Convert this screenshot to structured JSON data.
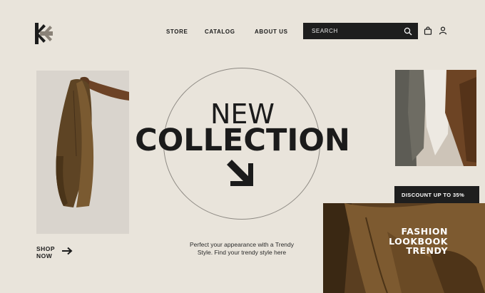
{
  "brand": {
    "logo_icon": "geometric-asterisk-logo"
  },
  "nav": [
    {
      "label": "STORE"
    },
    {
      "label": "CATALOG"
    },
    {
      "label": "ABOUT US"
    }
  ],
  "search": {
    "placeholder": "SEARCH",
    "icon": "search-icon"
  },
  "header_icons": {
    "bag": "shopping-bag-icon",
    "user": "user-icon"
  },
  "hero": {
    "line1": "NEW",
    "line2": "COLLECTION",
    "arrow_icon": "arrow-down-right-icon"
  },
  "tagline": "Perfect your appearance with a Trendy Style. Find your trendy style here",
  "shop": {
    "line1": "SHOP",
    "line2": "NOW",
    "icon": "arrow-right-icon"
  },
  "discount": {
    "label": "DISCOUNT UP TO 35%"
  },
  "lookbook": {
    "line1": "FASHION",
    "line2": "LOOKBOOK",
    "line3": "TRENDY"
  },
  "colors": {
    "background": "#e9e4db",
    "dark": "#1e1e1e",
    "accent_brown": "#6b4a26",
    "logo_gray": "#8a8278"
  }
}
